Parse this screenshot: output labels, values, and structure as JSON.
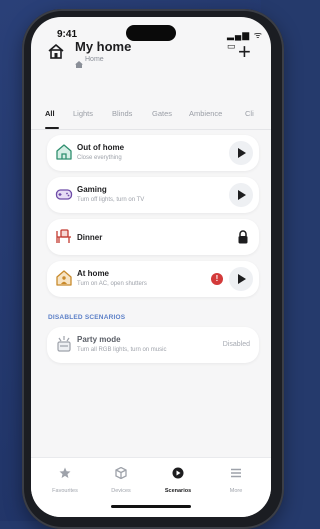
{
  "status": {
    "time": "9:41",
    "icons": "▂▄▆ ᯤ ▭"
  },
  "header": {
    "title": "My home",
    "subtitle": "Home"
  },
  "tabs": [
    "All",
    "Lights",
    "Blinds",
    "Gates",
    "Ambience",
    "Cli"
  ],
  "scenarios": [
    {
      "name": "Out of home",
      "desc": "Close everything",
      "icon": "house-leaving-icon",
      "action": "play"
    },
    {
      "name": "Gaming",
      "desc": "Turn off lights, turn on TV",
      "icon": "gamepad-icon",
      "action": "play"
    },
    {
      "name": "Dinner",
      "desc": "",
      "icon": "dinner-table-icon",
      "action": "lock"
    },
    {
      "name": "At home",
      "desc": "Turn on AC, open shutters",
      "icon": "house-person-icon",
      "action": "play",
      "alert": "!"
    }
  ],
  "disabled_section": {
    "label": "DISABLED SCENARIOS",
    "items": [
      {
        "name": "Party mode",
        "desc": "Turn all RGB lights, turn on music",
        "icon": "party-lights-icon",
        "status": "Disabled"
      }
    ]
  },
  "bottom_nav": [
    {
      "label": "Favourites",
      "icon": "star-icon"
    },
    {
      "label": "Devices",
      "icon": "cube-icon"
    },
    {
      "label": "Scenarios",
      "icon": "play-circle-icon",
      "active": true
    },
    {
      "label": "More",
      "icon": "menu-icon"
    }
  ]
}
